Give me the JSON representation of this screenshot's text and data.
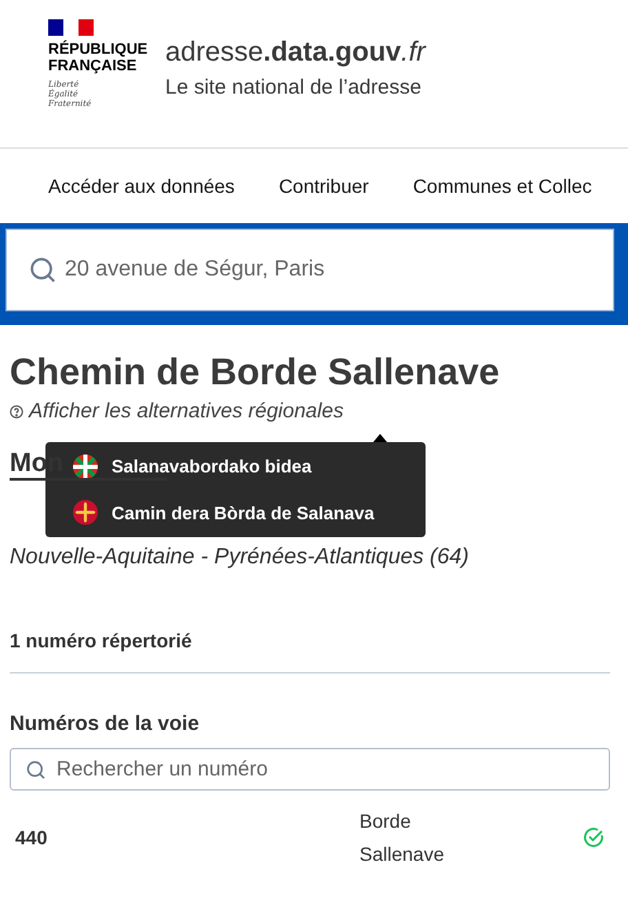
{
  "header": {
    "logo_lines": [
      "RÉPUBLIQUE",
      "FRANÇAISE"
    ],
    "motto": [
      "Liberté",
      "Égalité",
      "Fraternité"
    ],
    "site_name": {
      "prefix": "adresse",
      "bold": ".data.gouv",
      "suffix": ".fr"
    },
    "tagline": "Le site national de l’adresse"
  },
  "nav": [
    "Accéder aux données",
    "Contribuer",
    "Communes et Collec"
  ],
  "search": {
    "placeholder": "20 avenue de Ségur, Paris"
  },
  "street": {
    "title": "Chemin de Borde Sallenave",
    "alternatives_link": "Afficher les alternatives régionales",
    "commune": "Mon",
    "region": "Nouvelle-Aquitaine - Pyrénées-Atlantiques (64)"
  },
  "tooltip": [
    {
      "kind": "basque",
      "name": "Salanavabordako bidea"
    },
    {
      "kind": "occitan",
      "name": "Camin dera Bòrda de Salanava"
    }
  ],
  "count": "1 numéro répertorié",
  "numbers": {
    "title": "Numéros de la voie",
    "placeholder": "Rechercher un numéro",
    "rows": [
      {
        "number": "440",
        "street": "Borde Sallenave",
        "certified": true
      }
    ]
  }
}
